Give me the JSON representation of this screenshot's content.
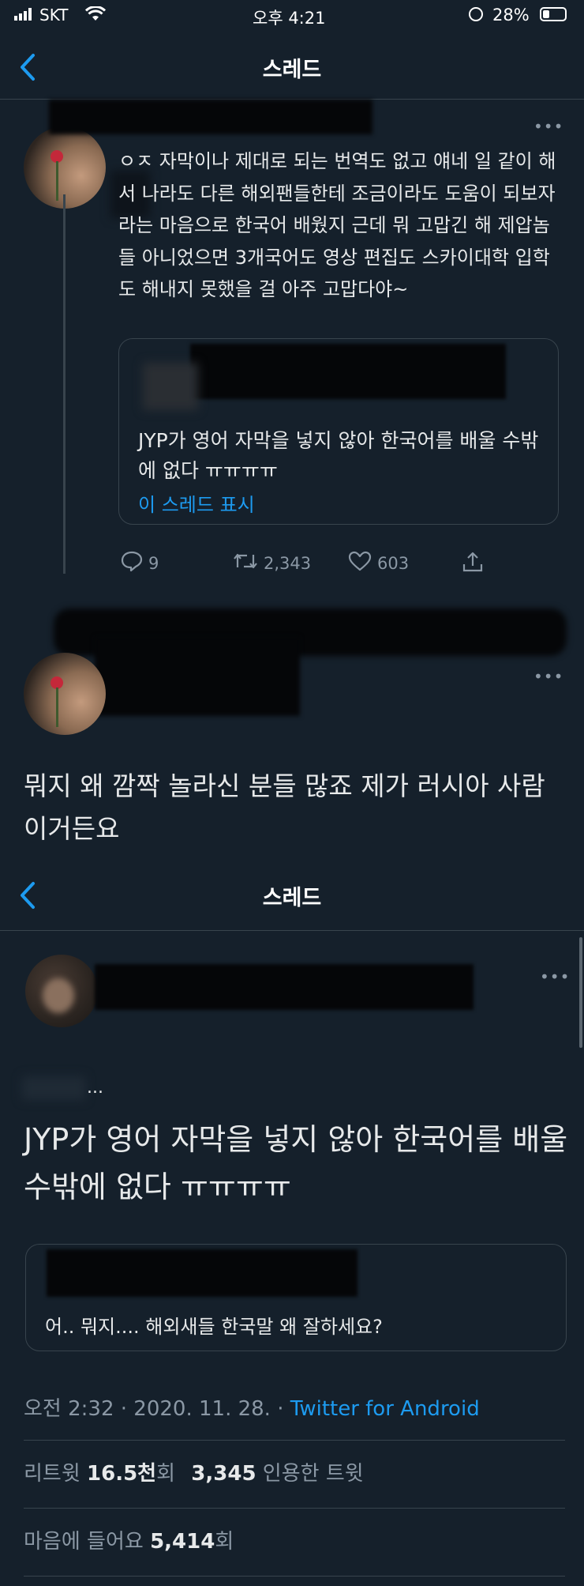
{
  "status_bar": {
    "carrier": "SKT",
    "time": "오후 4:21",
    "battery": "28%"
  },
  "nav": {
    "title": "스레드"
  },
  "tweet1": {
    "text": "ㅇㅈ 자막이나 제대로 되는 번역도 없고 얘네 일 같이 해서 나라도 다른 해외팬들한테 조금이라도 도움이 되보자라는 마음으로 한국어 배웠지 근데 뭐 고맙긴 해 제압놈들 아니었으면 3개국어도 영상 편집도 스카이대학 입학도 해내지 못했을 걸 아주 고맙다야~",
    "quote_text": "JYP가 영어 자막을 넣지 않아 한국어를 배울 수밖에 없다 ㅠㅠㅠㅠ",
    "quote_link": "이 스레드 표시",
    "replies": "9",
    "retweets": "2,343",
    "likes": "603"
  },
  "tweet2": {
    "text": "뭐지 왜 깜짝 놀라신 분들 많죠 제가 러시아 사람이거든요"
  },
  "nav2": {
    "title": "스레드"
  },
  "main_tweet": {
    "ellipsis": "...",
    "text": "JYP가 영어 자막을 넣지 않아 한국어를 배울 수밖에 없다 ㅠㅠㅠㅠ",
    "quote_text": "어.. 뭐지.... 해외새들 한국말 왜 잘하세요?",
    "time": "오전 2:32 · 2020. 11. 28. · ",
    "source": "Twitter for Android",
    "retweet_label": "리트윗 ",
    "retweet_count": "16.5천",
    "retweet_suffix": "회",
    "quote_count": "3,345",
    "quote_label": " 인용한 트윗",
    "like_label": "마음에 들어요 ",
    "like_count": "5,414",
    "like_suffix": "회"
  }
}
